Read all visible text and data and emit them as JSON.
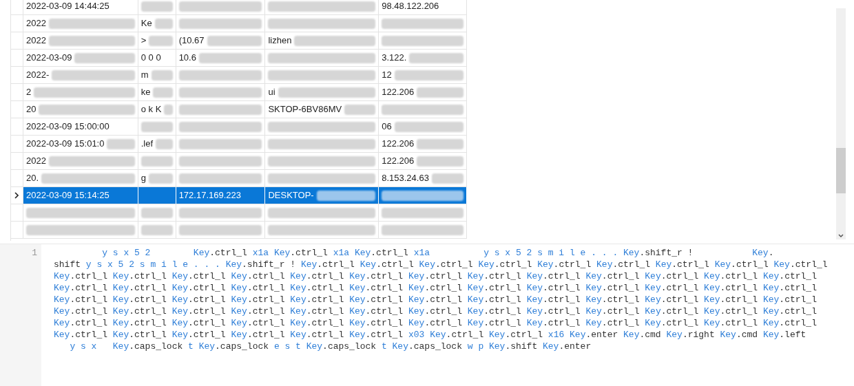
{
  "table": {
    "rows": [
      {
        "selected": false,
        "cells": [
          {
            "text": "2022-03-09 14:44:25",
            "blurred": false
          },
          {
            "blurred": true
          },
          {
            "blurred": true
          },
          {
            "blurred": true
          },
          {
            "text": "98.48.122.206",
            "blurred": false
          }
        ]
      },
      {
        "selected": false,
        "cells": [
          {
            "text": "2022",
            "blurred": true
          },
          {
            "text": "Ke",
            "blurred": true
          },
          {
            "blurred": true
          },
          {
            "blurred": true
          },
          {
            "blurred": true
          }
        ]
      },
      {
        "selected": false,
        "cells": [
          {
            "text": "2022",
            "blurred": true
          },
          {
            "text": ">",
            "blurred": true
          },
          {
            "text": "(10.67",
            "blurred": true
          },
          {
            "text": "lizhen",
            "blurred": true
          },
          {
            "blurred": true
          }
        ]
      },
      {
        "selected": false,
        "cells": [
          {
            "text": "2022-03-09",
            "blurred": true
          },
          {
            "text": "0 0 0",
            "blurred": false
          },
          {
            "text": "10.6",
            "blurred": true
          },
          {
            "blurred": true
          },
          {
            "text": "3.122.",
            "blurred": true
          }
        ]
      },
      {
        "selected": false,
        "cells": [
          {
            "text": "2022-",
            "blurred": true
          },
          {
            "text": "m",
            "blurred": true
          },
          {
            "blurred": true
          },
          {
            "blurred": true
          },
          {
            "text": "12",
            "blurred": true
          }
        ]
      },
      {
        "selected": false,
        "cells": [
          {
            "text": "2",
            "blurred": true
          },
          {
            "text": "ke",
            "blurred": true
          },
          {
            "blurred": true
          },
          {
            "text": "ui",
            "blurred": true
          },
          {
            "text": "122.206",
            "blurred": true
          }
        ]
      },
      {
        "selected": false,
        "cells": [
          {
            "text": "20",
            "blurred": true
          },
          {
            "text": "o k K",
            "blurred": true
          },
          {
            "blurred": true
          },
          {
            "text": "SKTOP-6BV86MV",
            "blurred": true
          },
          {
            "blurred": true
          }
        ]
      },
      {
        "selected": false,
        "cells": [
          {
            "text": "2022-03-09 15:00:00",
            "blurred": false
          },
          {
            "blurred": true
          },
          {
            "blurred": true
          },
          {
            "blurred": true
          },
          {
            "text": "06",
            "blurred": true
          }
        ]
      },
      {
        "selected": false,
        "cells": [
          {
            "text": "2022-03-09 15:01:0",
            "blurred": true
          },
          {
            "text": ".lef",
            "blurred": true
          },
          {
            "blurred": true
          },
          {
            "blurred": true
          },
          {
            "text": "122.206",
            "blurred": true
          }
        ]
      },
      {
        "selected": false,
        "cells": [
          {
            "text": "2022",
            "blurred": true
          },
          {
            "blurred": true
          },
          {
            "blurred": true
          },
          {
            "blurred": true
          },
          {
            "text": "122.206",
            "blurred": true
          }
        ]
      },
      {
        "selected": false,
        "cells": [
          {
            "text": "20.",
            "blurred": true
          },
          {
            "text": "g",
            "blurred": true
          },
          {
            "blurred": true
          },
          {
            "blurred": true
          },
          {
            "text": "8.153.24.63",
            "blurred": true
          }
        ]
      },
      {
        "selected": true,
        "cells": [
          {
            "text": "2022-03-09 15:14:25",
            "blurred": false
          },
          {
            "blurred": false
          },
          {
            "text": "172.17.169.223",
            "blurred": false
          },
          {
            "text": "DESKTOP-",
            "blurred": true
          },
          {
            "blurred": true
          }
        ]
      },
      {
        "selected": false,
        "cells": [
          {
            "blurred": true
          },
          {
            "blurred": true
          },
          {
            "blurred": true
          },
          {
            "blurred": true
          },
          {
            "blurred": true
          }
        ]
      },
      {
        "selected": false,
        "cells": [
          {
            "blurred": true
          },
          {
            "blurred": true
          },
          {
            "blurred": true
          },
          {
            "blurred": true
          },
          {
            "blurred": true
          }
        ]
      }
    ]
  },
  "editor": {
    "line_number": "1",
    "lines": [
      {
        "key_first": true,
        "segments": [
          "         y s x 5 2        Key",
          ".ctrl_l ",
          "x1a Key",
          ".ctrl_l ",
          "x1a Key",
          ".ctrl_l ",
          "x1a          y s x 5 2 s m i l e . . . Key",
          ".shift_r !           ",
          "Key",
          "."
        ]
      },
      {
        "key_first": false,
        "segments": [
          "shift ",
          "y s x 5 2 s m i l e . . . Key",
          ".shift_r ! ",
          "Key",
          ".ctrl_l ",
          "Key",
          ".ctrl_l ",
          "Key",
          ".ctrl_l ",
          "Key",
          ".ctrl_l ",
          "Key",
          ".ctrl_l ",
          "Key",
          ".ctrl_l ",
          "Key",
          ".ctrl_l ",
          "Key",
          ".ctrl_l ",
          "Key",
          ".ctrl_l"
        ]
      },
      {
        "key_first": true,
        "segments": [
          "Key",
          ".ctrl_l ",
          "Key",
          ".ctrl_l ",
          "Key",
          ".ctrl_l ",
          "Key",
          ".ctrl_l ",
          "Key",
          ".ctrl_l ",
          "Key",
          ".ctrl_l ",
          "Key",
          ".ctrl_l ",
          "Key",
          ".ctrl_l ",
          "Key",
          ".ctrl_l ",
          "Key",
          ".ctrl_l ",
          "Key",
          ".ctrl_l ",
          "Key",
          ".ctrl_l ",
          "Key",
          ".ctrl_l"
        ]
      },
      {
        "key_first": true,
        "segments": [
          "Key",
          ".ctrl_l ",
          "Key",
          ".ctrl_l ",
          "Key",
          ".ctrl_l ",
          "Key",
          ".ctrl_l ",
          "Key",
          ".ctrl_l ",
          "Key",
          ".ctrl_l ",
          "Key",
          ".ctrl_l ",
          "Key",
          ".ctrl_l ",
          "Key",
          ".ctrl_l ",
          "Key",
          ".ctrl_l ",
          "Key",
          ".ctrl_l ",
          "Key",
          ".ctrl_l ",
          "Key",
          ".ctrl_l"
        ]
      },
      {
        "key_first": true,
        "segments": [
          "Key",
          ".ctrl_l ",
          "Key",
          ".ctrl_l ",
          "Key",
          ".ctrl_l ",
          "Key",
          ".ctrl_l ",
          "Key",
          ".ctrl_l ",
          "Key",
          ".ctrl_l ",
          "Key",
          ".ctrl_l ",
          "Key",
          ".ctrl_l ",
          "Key",
          ".ctrl_l ",
          "Key",
          ".ctrl_l ",
          "Key",
          ".ctrl_l ",
          "Key",
          ".ctrl_l ",
          "Key",
          ".ctrl_l"
        ]
      },
      {
        "key_first": true,
        "segments": [
          "Key",
          ".ctrl_l ",
          "Key",
          ".ctrl_l ",
          "Key",
          ".ctrl_l ",
          "Key",
          ".ctrl_l ",
          "Key",
          ".ctrl_l ",
          "Key",
          ".ctrl_l ",
          "Key",
          ".ctrl_l ",
          "Key",
          ".ctrl_l ",
          "Key",
          ".ctrl_l ",
          "Key",
          ".ctrl_l ",
          "Key",
          ".ctrl_l ",
          "Key",
          ".ctrl_l ",
          "Key",
          ".ctrl_l"
        ]
      },
      {
        "key_first": true,
        "segments": [
          "Key",
          ".ctrl_l ",
          "Key",
          ".ctrl_l ",
          "Key",
          ".ctrl_l ",
          "Key",
          ".ctrl_l ",
          "Key",
          ".ctrl_l ",
          "Key",
          ".ctrl_l ",
          "Key",
          ".ctrl_l ",
          "Key",
          ".ctrl_l ",
          "Key",
          ".ctrl_l ",
          "Key",
          ".ctrl_l ",
          "Key",
          ".ctrl_l ",
          "Key",
          ".ctrl_l ",
          "Key",
          ".ctrl_l"
        ]
      },
      {
        "key_first": true,
        "segments": [
          "Key",
          ".ctrl_l ",
          "Key",
          ".ctrl_l ",
          "Key",
          ".ctrl_l ",
          "Key",
          ".ctrl_l ",
          "Key",
          ".ctrl_l ",
          "Key",
          ".ctrl_l ",
          "x03 Key",
          ".ctrl_l ",
          "Key",
          ".ctrl_l ",
          "x16 Key",
          ".enter ",
          "Key",
          ".cmd ",
          "Key",
          ".right ",
          "Key",
          ".cmd ",
          "Key",
          ".left"
        ]
      },
      {
        "key_first": true,
        "segments": [
          "   y s x   Key",
          ".caps_lock ",
          "t Key",
          ".caps_lock ",
          "e s t Key",
          ".caps_lock ",
          "t Key",
          ".caps_lock ",
          "w p Key",
          ".shift ",
          "Key",
          ".enter"
        ]
      }
    ]
  }
}
